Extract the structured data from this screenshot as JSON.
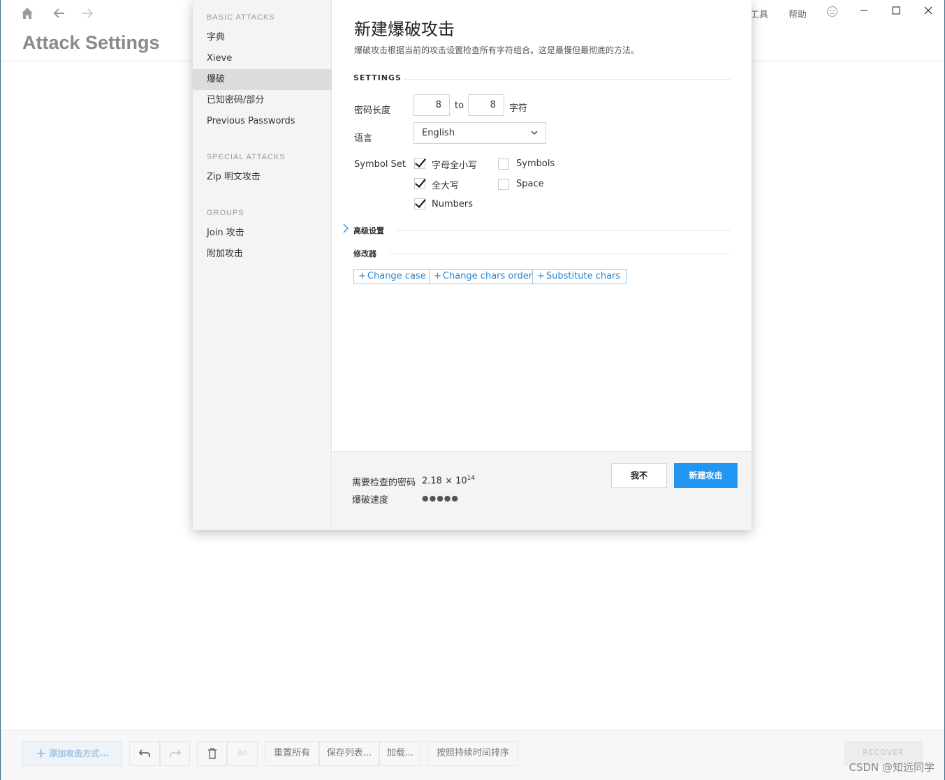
{
  "app": {
    "title": "Attack Settings",
    "menu": {
      "tools": "工具",
      "help": "帮助"
    },
    "bottom": {
      "add_attack": "添加攻击方式...",
      "all": "All",
      "reset_all": "重置所有",
      "save_list": "保存列表...",
      "load": "加载...",
      "sort_by_duration": "按照持续时间排序",
      "recover": "RECOVER"
    },
    "watermark": "CSDN @知远同学"
  },
  "modal": {
    "sidebar": {
      "basic_heading": "BASIC ATTACKS",
      "basic_items": [
        {
          "label": "字典"
        },
        {
          "label": "Xieve"
        },
        {
          "label": "爆破"
        },
        {
          "label": "已知密码/部分"
        },
        {
          "label": "Previous Passwords"
        }
      ],
      "special_heading": "SPECIAL ATTACKS",
      "special_items": [
        {
          "label": "Zip 明文攻击"
        }
      ],
      "groups_heading": "GROUPS",
      "groups_items": [
        {
          "label": "Join 攻击"
        },
        {
          "label": "附加攻击"
        }
      ]
    },
    "title": "新建爆破攻击",
    "subtitle": "爆破攻击根据当前的攻击设置检查所有字符组合。这是最慢但最彻底的方法。",
    "settings": {
      "heading": "SETTINGS",
      "length_label": "密码长度",
      "length_from": "8",
      "to_text": "to",
      "length_to": "8",
      "unit": "字符",
      "language_label": "语言",
      "language_value": "English",
      "symbol_set_label": "Symbol Set",
      "symbols": [
        {
          "label": "字母全小写",
          "checked": true
        },
        {
          "label": "全大写",
          "checked": true
        },
        {
          "label": "Numbers",
          "checked": true
        },
        {
          "label": "Symbols",
          "checked": false
        },
        {
          "label": "Space",
          "checked": false
        }
      ]
    },
    "advanced_heading": "高级设置",
    "modifiers_heading": "修改器",
    "modifier_buttons": [
      "Change case",
      "Change chars order",
      "Substitute chars"
    ],
    "footer": {
      "passwords_label": "需要检查的密码",
      "passwords_mantissa": "2.18 × 10",
      "passwords_exponent": "14",
      "speed_label": "爆破速度",
      "speed_dots": "●●●●●",
      "cancel": "我不",
      "create": "新建攻击"
    }
  }
}
